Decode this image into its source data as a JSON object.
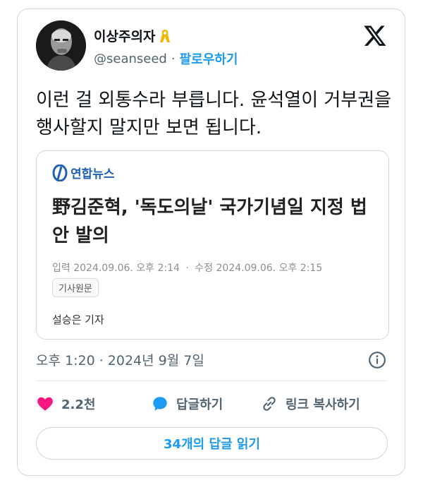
{
  "author": {
    "display_name": "이상주의자",
    "badge_icon": "yellow-ribbon-icon",
    "handle": "@seanseed",
    "separator": "·",
    "follow_label": "팔로우하기"
  },
  "tweet": {
    "text": "이런 걸 외통수라 부릅니다. 윤석열이 거부권을 행사할지 말지만 보면 됩니다.",
    "timestamp": "오후 1:20 · 2024년 9월 7일"
  },
  "link_card": {
    "source": "연합뉴스",
    "headline": "野김준혁, '독도의날' 국가기념일 지정 법안 발의",
    "input_label": "입력",
    "input_time": "2024.09.06. 오후 2:14",
    "meta_sep": "·",
    "edit_label": "수정",
    "edit_time": "2024.09.06. 오후 2:15",
    "origin_button": "기사원문",
    "reporter": "설승은 기자"
  },
  "actions": {
    "likes": "2.2천",
    "reply_label": "답글하기",
    "copy_link_label": "링크 복사하기",
    "read_replies": "34개의 답글 읽기"
  },
  "colors": {
    "accent": "#1d9bf0",
    "like": "#f91880",
    "muted": "#536471",
    "brand": "#1e60b4"
  }
}
